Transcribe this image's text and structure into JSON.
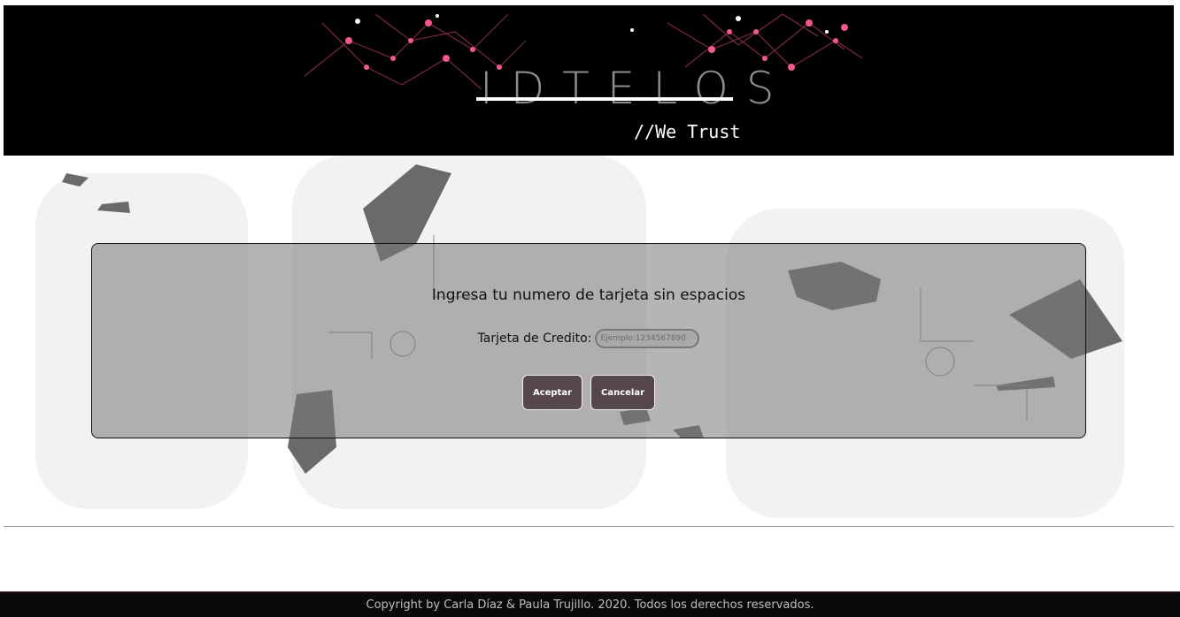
{
  "header": {
    "logo": "IDTELOS",
    "tagline": "//We Trust"
  },
  "form": {
    "title": "Ingresa tu numero de tarjeta sin espacios",
    "card_label": "Tarjeta de Credito:",
    "card_placeholder": "Ejemplo:1234567890",
    "card_value": "",
    "accept_label": "Aceptar",
    "cancel_label": "Cancelar"
  },
  "footer": {
    "copyright": "Copyright by Carla Díaz & Paula Trujillo. 2020. Todos los derechos reservados."
  },
  "colors": {
    "header_bg": "#000000",
    "button_bg": "#55474a",
    "circuit_accent": "#e0306a",
    "footer_bg": "#0a0a0a"
  }
}
